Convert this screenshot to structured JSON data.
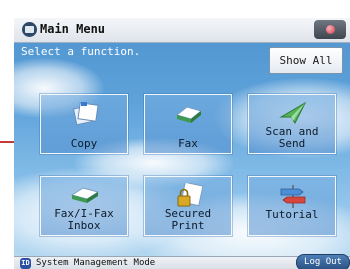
{
  "header": {
    "title": "Main Menu"
  },
  "subtitle": "Select a function.",
  "show_all_label": "Show All",
  "functions": [
    {
      "label_line1": "Copy",
      "label_line2": "",
      "icon": "copy-icon"
    },
    {
      "label_line1": "Fax",
      "label_line2": "",
      "icon": "fax-icon"
    },
    {
      "label_line1": "Scan and",
      "label_line2": "Send",
      "icon": "scan-send-icon"
    },
    {
      "label_line1": "Fax/I-Fax",
      "label_line2": "Inbox",
      "icon": "fax-inbox-icon"
    },
    {
      "label_line1": "Secured",
      "label_line2": "Print",
      "icon": "secured-print-icon"
    },
    {
      "label_line1": "Tutorial",
      "label_line2": "",
      "icon": "tutorial-icon"
    }
  ],
  "bottom_bar": {
    "id_badge": "ID",
    "message": "System Management Mode",
    "logout_label": "Log Out"
  },
  "colors": {
    "sky": "#5fa3db",
    "accent_red": "#c23a3a",
    "logout": "#294f80"
  }
}
